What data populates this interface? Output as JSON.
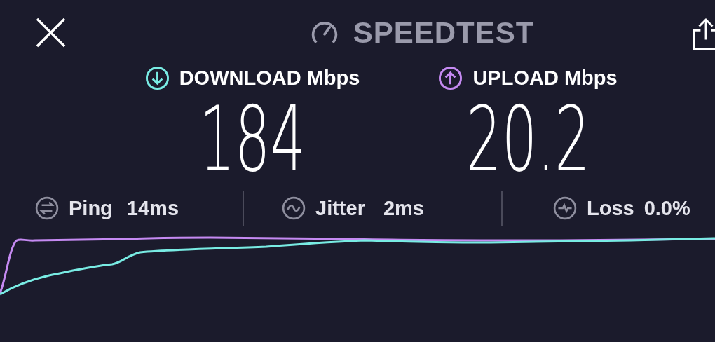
{
  "header": {
    "title": "SPEEDTEST"
  },
  "results": [
    {
      "kind": "download",
      "label": "DOWNLOAD Mbps",
      "value": "184",
      "color": "#79ece4"
    },
    {
      "kind": "upload",
      "label": "UPLOAD Mbps",
      "value": "20.2",
      "color": "#c58af2"
    }
  ],
  "stats": [
    {
      "kind": "ping",
      "label": "Ping",
      "value": "14ms"
    },
    {
      "kind": "jitter",
      "label": "Jitter",
      "value": "2ms"
    },
    {
      "kind": "loss",
      "label": "Loss",
      "value": "0.0%"
    }
  ]
}
